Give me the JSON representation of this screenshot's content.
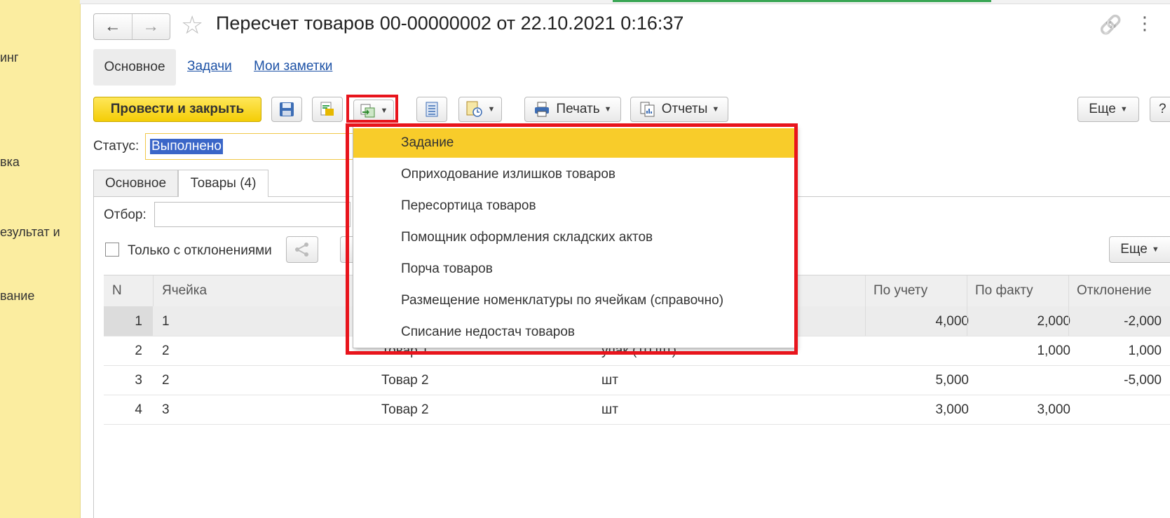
{
  "sidebar": {
    "items": [
      "инг",
      "вка",
      "езультат и",
      "вание"
    ]
  },
  "header": {
    "back_icon": "←",
    "forward_icon": "→",
    "star_icon": "☆",
    "title": "Пересчет товаров 00-00000002 от 22.10.2021 0:16:37",
    "link_icon": "🔗",
    "more_icon": "⋮"
  },
  "section_tabs": {
    "main": "Основное",
    "tasks": "Задачи",
    "notes": "Мои заметки"
  },
  "toolbar": {
    "post_close": "Провести и закрыть",
    "print": "Печать",
    "reports": "Отчеты",
    "more": "Еще",
    "help": "?"
  },
  "status": {
    "label": "Статус:",
    "value": "Выполнено"
  },
  "inner_tabs": {
    "main": "Основное",
    "goods": "Товары (4)"
  },
  "goods": {
    "filter_label": "Отбор:",
    "only_deviations": "Только с отклонениями",
    "more": "Еще",
    "columns": [
      "N",
      "Ячейка",
      "По учету",
      "По факту",
      "Отклонение"
    ],
    "rows": [
      {
        "n": "1",
        "cell": "1",
        "product": "",
        "unit": "",
        "book": "4,000",
        "fact": "2,000",
        "dev": "-2,000"
      },
      {
        "n": "2",
        "cell": "2",
        "product": "Товар 1",
        "unit": "упак (10 шт)",
        "book": "",
        "fact": "1,000",
        "dev": "1,000"
      },
      {
        "n": "3",
        "cell": "2",
        "product": "Товар 2",
        "unit": "шт",
        "book": "5,000",
        "fact": "",
        "dev": "-5,000"
      },
      {
        "n": "4",
        "cell": "3",
        "product": "Товар 2",
        "unit": "шт",
        "book": "3,000",
        "fact": "3,000",
        "dev": ""
      }
    ]
  },
  "menu": {
    "items": [
      "Задание",
      "Оприходование излишков товаров",
      "Пересортица товаров",
      "Помощник оформления складских актов",
      "Порча товаров",
      "Размещение номенклатуры по ячейкам (справочно)",
      "Списание недостач товаров"
    ]
  },
  "colors": {
    "sidebar": "#fbeda0",
    "primary_button": "#f4cd06",
    "menu_highlight": "#f8cc2a",
    "annotation_red": "#e8141c",
    "link": "#1d52a6"
  }
}
